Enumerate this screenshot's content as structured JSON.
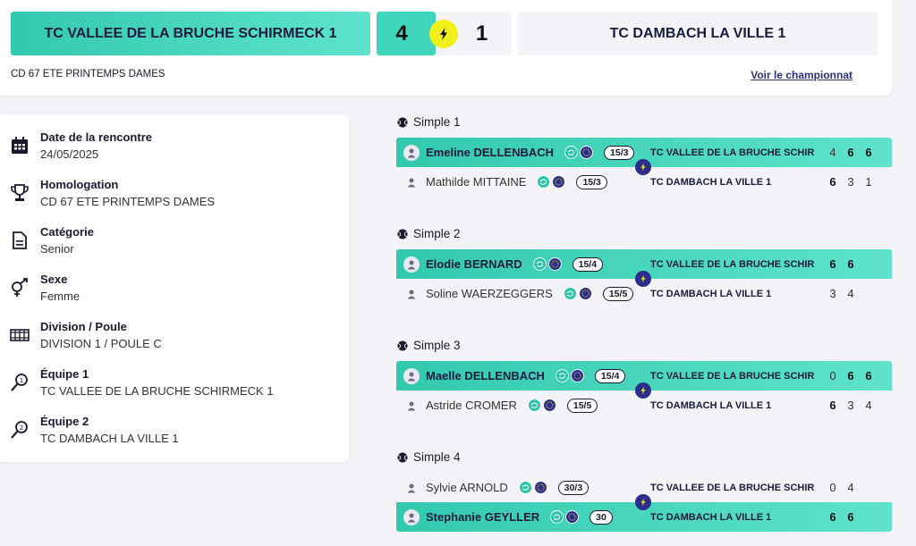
{
  "header": {
    "home_team": "TC VALLEE DE LA BRUCHE SCHIRMECK 1",
    "home_score": "4",
    "away_score": "1",
    "away_team": "TC DAMBACH LA VILLE 1",
    "competition": "CD 67 ETE PRINTEMPS DAMES",
    "champ_link": "Voir le championnat"
  },
  "info": [
    {
      "title": "Date de la rencontre",
      "value": "24/05/2025",
      "icon": "calendar-icon"
    },
    {
      "title": "Homologation",
      "value": "CD 67 ETE PRINTEMPS DAMES",
      "icon": "trophy-icon"
    },
    {
      "title": "Catégorie",
      "value": "Senior",
      "icon": "document-icon"
    },
    {
      "title": "Sexe",
      "value": "Femme",
      "icon": "gender-icon"
    },
    {
      "title": "Division / Poule",
      "value": "DIVISION 1 / POULE C",
      "icon": "court-icon"
    },
    {
      "title": "Équipe 1",
      "value": "TC VALLEE DE LA BRUCHE SCHIRMECK 1",
      "icon": "racket-1-icon"
    },
    {
      "title": "Équipe 2",
      "value": "TC DAMBACH LA VILLE 1",
      "icon": "racket-2-icon"
    }
  ],
  "matches": [
    {
      "label": "Simple 1",
      "top": {
        "name": "Emeline DELLENBACH",
        "rank": "15/3",
        "team": "TC VALLEE DE LA BRUCHE SCHIR...",
        "sets": [
          "4",
          "6",
          "6"
        ],
        "bold": [
          false,
          true,
          true
        ],
        "win": true
      },
      "bottom": {
        "name": "Mathilde MITTAINE",
        "rank": "15/3",
        "team": "TC DAMBACH LA VILLE 1",
        "sets": [
          "6",
          "3",
          "1"
        ],
        "bold": [
          true,
          false,
          false
        ],
        "win": false
      }
    },
    {
      "label": "Simple 2",
      "top": {
        "name": "Elodie BERNARD",
        "rank": "15/4",
        "team": "TC VALLEE DE LA BRUCHE SCHIR...",
        "sets": [
          "6",
          "6"
        ],
        "bold": [
          true,
          true
        ],
        "win": true
      },
      "bottom": {
        "name": "Soline WAERZEGGERS",
        "rank": "15/5",
        "team": "TC DAMBACH LA VILLE 1",
        "sets": [
          "3",
          "4"
        ],
        "bold": [
          false,
          false
        ],
        "win": false
      }
    },
    {
      "label": "Simple 3",
      "top": {
        "name": "Maelle DELLENBACH",
        "rank": "15/4",
        "team": "TC VALLEE DE LA BRUCHE SCHIR...",
        "sets": [
          "0",
          "6",
          "6"
        ],
        "bold": [
          false,
          true,
          true
        ],
        "win": true
      },
      "bottom": {
        "name": "Astride CROMER",
        "rank": "15/5",
        "team": "TC DAMBACH LA VILLE 1",
        "sets": [
          "6",
          "3",
          "4"
        ],
        "bold": [
          true,
          false,
          false
        ],
        "win": false
      }
    },
    {
      "label": "Simple 4",
      "top": {
        "name": "Sylvie ARNOLD",
        "rank": "30/3",
        "team": "TC VALLEE DE LA BRUCHE SCHIR...",
        "sets": [
          "0",
          "4"
        ],
        "bold": [
          false,
          false
        ],
        "win": false
      },
      "bottom": {
        "name": "Stephanie GEYLLER",
        "rank": "30",
        "team": "TC DAMBACH LA VILLE 1",
        "sets": [
          "6",
          "6"
        ],
        "bold": [
          true,
          true
        ],
        "win": true
      }
    }
  ],
  "colors": {
    "accent": "#3fd6bb",
    "bolt_yellow": "#f2f01a",
    "bolt_navy": "#2d2d8c",
    "link": "#2b2f7a",
    "badge_teal": "#2ec4a8",
    "badge_navy": "#2d2d8c"
  }
}
